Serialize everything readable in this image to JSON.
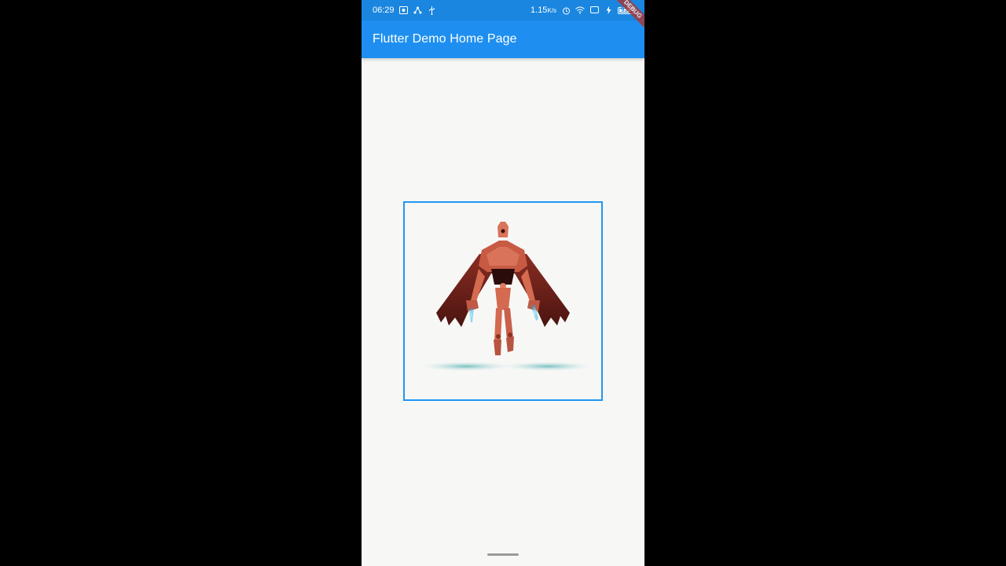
{
  "status_bar": {
    "time": "06:29",
    "network_speed": "1.15",
    "network_unit": "K/s",
    "battery": "93",
    "icons": [
      "photo-icon",
      "share-icon",
      "usb-icon",
      "alarm-icon",
      "wifi-icon",
      "screen-icon",
      "charging-icon"
    ]
  },
  "app_bar": {
    "title": "Flutter Demo Home Page"
  },
  "debug_banner": {
    "label": "DEBUG"
  },
  "colors": {
    "status_bar": "#1a86df",
    "app_bar": "#1e8ff0",
    "frame_border": "#2196f3",
    "background": "#f7f8f6",
    "debug_banner": "#a3393a"
  }
}
